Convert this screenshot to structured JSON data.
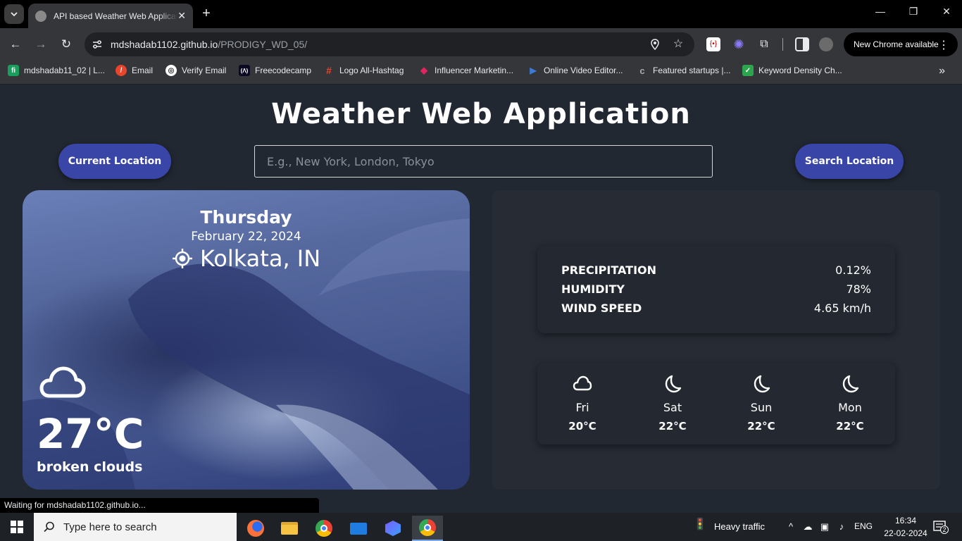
{
  "browser": {
    "tab_title": "API based Weather Web Application",
    "url_host": "mdshadab1102.github.io",
    "url_path": "/PRODIGY_WD_05/",
    "update_pill": "New Chrome available",
    "status_text": "Waiting for mdshadab1102.github.io..."
  },
  "bookmarks": [
    {
      "label": "mdshadab11_02 | L...",
      "color": "#1a9e5c",
      "glyph": "fi"
    },
    {
      "label": "Email",
      "color": "#e8452c",
      "glyph": "/"
    },
    {
      "label": "Verify Email",
      "color": "#ffffff",
      "glyph": "◎"
    },
    {
      "label": "Freecodecamp",
      "color": "#0a0a23",
      "glyph": "(Λ)"
    },
    {
      "label": "Logo All-Hashtag",
      "color": "#e8452c",
      "glyph": "#"
    },
    {
      "label": "Influencer Marketin...",
      "color": "#e0245e",
      "glyph": "◆"
    },
    {
      "label": "Online Video Editor...",
      "color": "#3d7bd9",
      "glyph": "▶"
    },
    {
      "label": "Featured startups |...",
      "color": "#222222",
      "glyph": "c"
    },
    {
      "label": "Keyword Density Ch...",
      "color": "#2da44e",
      "glyph": "✓"
    }
  ],
  "app": {
    "title": "Weather Web Application",
    "current_location_button": "Current Location",
    "search_button": "Search Location",
    "search_placeholder": "E.g., New York, London, Tokyo"
  },
  "current": {
    "day": "Thursday",
    "date": "February 22, 2024",
    "location": "Kolkata, IN",
    "temperature": "27°C",
    "description": "broken clouds",
    "icon": "cloud-icon"
  },
  "stats": {
    "precipitation_label": "PRECIPITATION",
    "precipitation_value": "0.12%",
    "humidity_label": "HUMIDITY",
    "humidity_value": "78%",
    "wind_label": "WIND SPEED",
    "wind_value": "4.65 km/h"
  },
  "forecast": [
    {
      "day": "Fri",
      "temp": "20°C",
      "icon": "cloud-icon"
    },
    {
      "day": "Sat",
      "temp": "22°C",
      "icon": "moon-icon"
    },
    {
      "day": "Sun",
      "temp": "22°C",
      "icon": "moon-icon"
    },
    {
      "day": "Mon",
      "temp": "22°C",
      "icon": "moon-icon"
    }
  ],
  "taskbar": {
    "search_placeholder": "Type here to search",
    "weather_text": "Heavy traffic",
    "language": "ENG",
    "time": "16:34",
    "date": "22-02-2024",
    "notification_count": "2"
  }
}
